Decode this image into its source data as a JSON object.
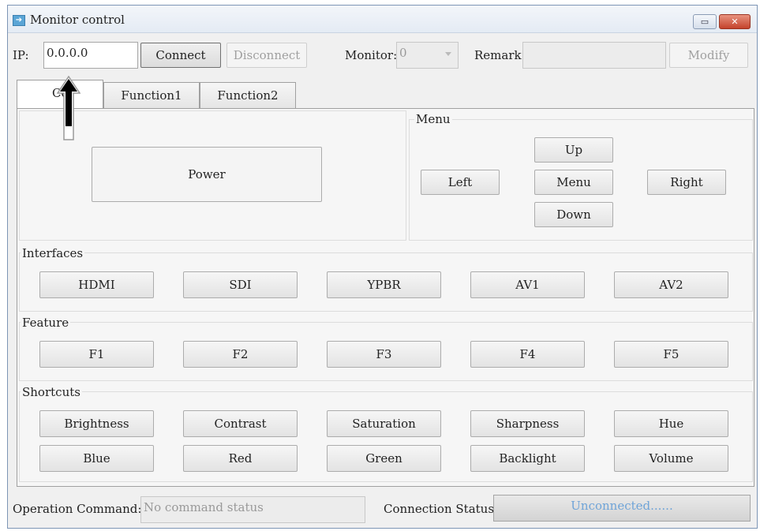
{
  "window": {
    "title": "Monitor control",
    "minimize": "▭",
    "close": "✕"
  },
  "toolbar": {
    "ip_label": "IP:",
    "ip_value": "0.0.0.0",
    "connect": "Connect",
    "disconnect": "Disconnect",
    "monitor_label": "Monitor:",
    "monitor_value": "0",
    "remark_label": "Remark:",
    "remark_value": "",
    "modify": "Modify"
  },
  "tabs": [
    {
      "label": "Control",
      "partially_visible": "Cc"
    },
    {
      "label": "Function1"
    },
    {
      "label": "Function2"
    }
  ],
  "power": {
    "label": "Power"
  },
  "menu": {
    "title": "Menu",
    "up": "Up",
    "left": "Left",
    "menu": "Menu",
    "right": "Right",
    "down": "Down"
  },
  "interfaces": {
    "title": "Interfaces",
    "buttons": [
      "HDMI",
      "SDI",
      "YPBR",
      "AV1",
      "AV2"
    ]
  },
  "feature": {
    "title": "Feature",
    "buttons": [
      "F1",
      "F2",
      "F3",
      "F4",
      "F5"
    ]
  },
  "shortcuts": {
    "title": "Shortcuts",
    "row1": [
      "Brightness",
      "Contrast",
      "Saturation",
      "Sharpness",
      "Hue"
    ],
    "row2": [
      "Blue",
      "Red",
      "Green",
      "Backlight",
      "Volume"
    ]
  },
  "status": {
    "operation_label": "Operation Command:",
    "operation_value": "No command status",
    "connection_label": "Connection Status:",
    "connection_value": "Unconnected......"
  },
  "colors": {
    "accent": "#6fa4d8",
    "close": "#c4432c"
  }
}
